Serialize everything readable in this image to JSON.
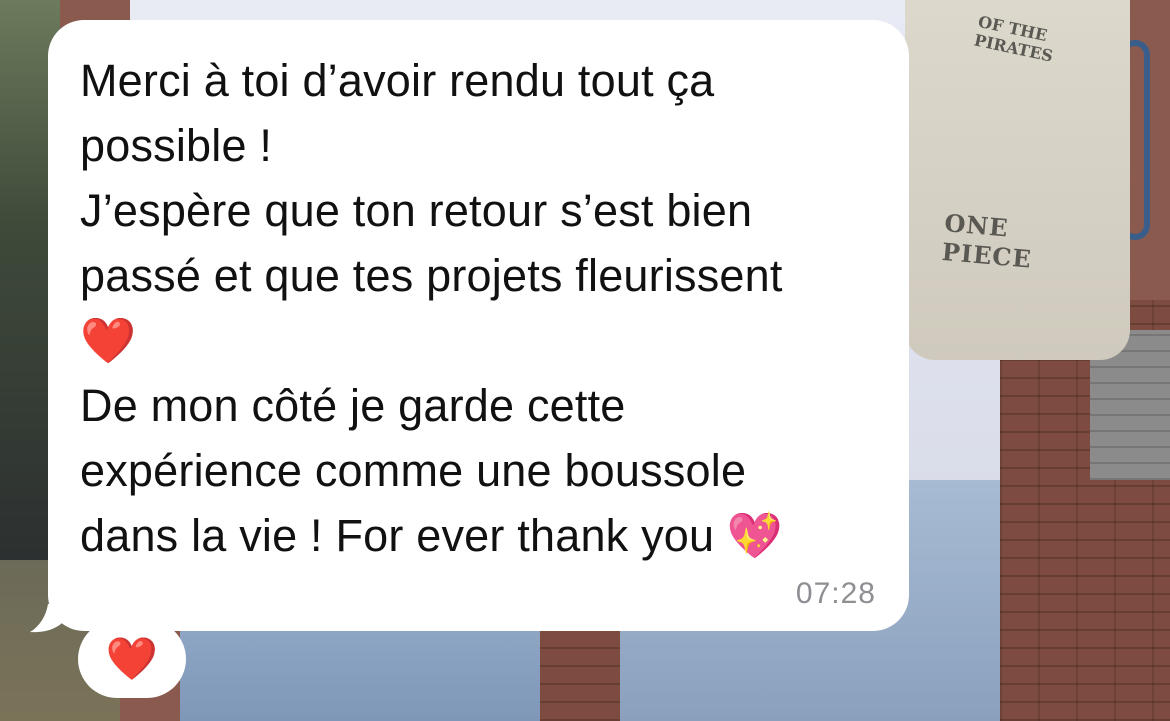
{
  "message": {
    "text": "Merci à toi d’avoir rendu tout ça\npossible !\nJ’espère que ton retour s’est bien\npassé et que tes projets fleurissent\n❤️\nDe mon côté je garde cette\nexpérience comme une boussole\ndans la vie ! For ever thank you 💖",
    "timestamp": "07:28"
  },
  "reaction": {
    "emoji": "❤️",
    "icon": "red-heart-icon"
  },
  "background": {
    "tote_print_top": "OF THE PIRATES",
    "tote_print_bottom": "ONE PIECE"
  },
  "colors": {
    "bubble": "#ffffff",
    "text": "#111111",
    "timestamp": "#8e8e93",
    "heart": "#e0232d"
  }
}
